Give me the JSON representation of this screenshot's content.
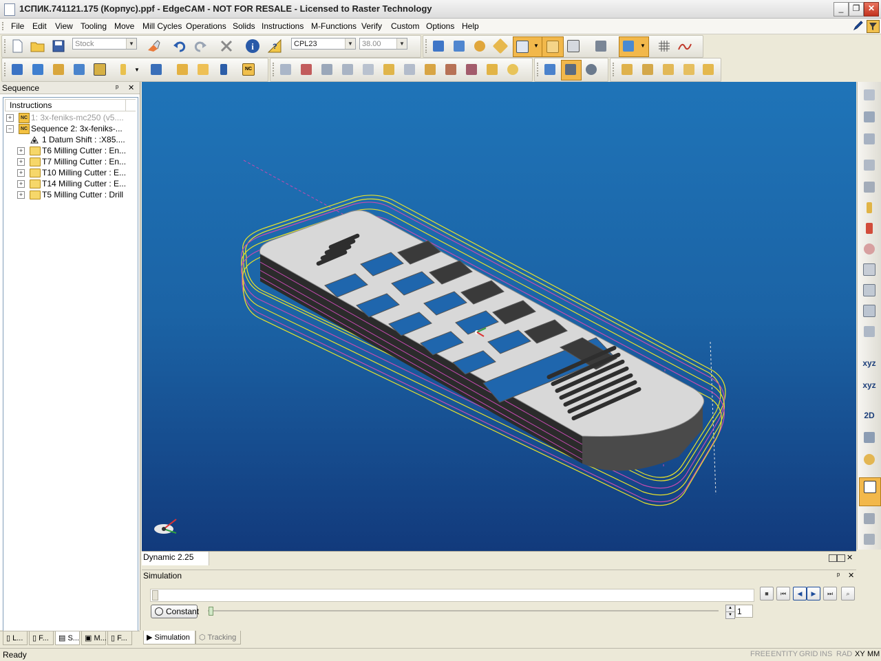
{
  "window": {
    "title": "1СПИК.741121.175 (Корпус).ppf - EdgeCAM - NOT FOR RESALE - Licensed to Raster Technology",
    "minimize": "_",
    "maximize": "❐",
    "close": "✕"
  },
  "menu": [
    "File",
    "Edit",
    "View",
    "Tooling",
    "Move",
    "Mill Cycles",
    "Operations",
    "Solids",
    "Instructions",
    "M-Functions",
    "Verify",
    "Custom",
    "Options",
    "Help"
  ],
  "toolbar": {
    "layer_combo": "Stock",
    "cpl_combo": "CPL23",
    "depth_combo": "38.00"
  },
  "sequence_panel": {
    "title": "Sequence",
    "pin": "ᵖ",
    "close": "✕",
    "header": "Instructions",
    "items": [
      {
        "label": "1: 3x-feniks-mc250 (v5....",
        "expander": "+",
        "icon": "nc-icon"
      },
      {
        "label": "Sequence 2: 3x-feniks-...",
        "expander": "−",
        "icon": "nc-icon"
      },
      {
        "label": "1 Datum Shift :  :X85....",
        "expander": "",
        "icon": "datum-shift-icon"
      },
      {
        "label": "T6 Milling Cutter : En...",
        "expander": "+",
        "icon": "folder-icon"
      },
      {
        "label": "T7 Milling Cutter : En...",
        "expander": "+",
        "icon": "folder-icon"
      },
      {
        "label": "T10 Milling Cutter : E...",
        "expander": "+",
        "icon": "folder-icon"
      },
      {
        "label": "T14 Milling Cutter : E...",
        "expander": "+",
        "icon": "folder-icon"
      },
      {
        "label": "T5 Milling Cutter : Drill",
        "expander": "+",
        "icon": "folder-icon"
      }
    ],
    "bottom_tabs": [
      "L...",
      "F...",
      "S...",
      "M...",
      "F..."
    ]
  },
  "viewport": {
    "status": "Dynamic 2.25"
  },
  "simulation_panel": {
    "title": "Simulation",
    "speed_button": "Constant",
    "step_value": "1",
    "tabs": [
      "Simulation",
      "Tracking"
    ]
  },
  "statusbar": {
    "status": "Ready",
    "indicators": [
      "FREE",
      "ENTITY",
      "GRID",
      "INS",
      "RAD",
      "XY",
      "MM"
    ]
  },
  "colors": {
    "viewport_top": "#1f74b8",
    "viewport_bottom": "#123a7c",
    "toolpath_yellow": "#e8e22a",
    "toolpath_magenta": "#c44bb0",
    "part_gray": "#d8d8d8"
  }
}
